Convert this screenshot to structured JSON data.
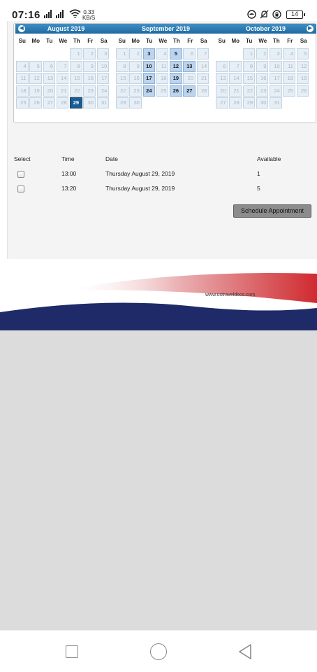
{
  "status_bar": {
    "time": "07:16",
    "speed_value": "0.33",
    "speed_unit": "KB/S",
    "battery": "14"
  },
  "calendar": {
    "weekdays": [
      "Su",
      "Mo",
      "Tu",
      "We",
      "Th",
      "Fr",
      "Sa"
    ],
    "months": [
      {
        "title": "August 2019",
        "offset": 4,
        "days": 31,
        "available": [],
        "selected": 29
      },
      {
        "title": "September 2019",
        "offset": 0,
        "days": 30,
        "available": [
          3,
          5,
          10,
          12,
          13,
          17,
          19,
          24,
          26,
          27
        ],
        "selected": null
      },
      {
        "title": "October 2019",
        "offset": 2,
        "days": 31,
        "available": [],
        "selected": null
      }
    ]
  },
  "slots": {
    "headers": {
      "select": "Select",
      "time": "Time",
      "date": "Date",
      "available": "Available"
    },
    "rows": [
      {
        "time": "13:00",
        "date": "Thursday August 29, 2019",
        "available": "1"
      },
      {
        "time": "13:20",
        "date": "Thursday August 29, 2019",
        "available": "5"
      }
    ]
  },
  "schedule_button": "Schedule Appointment",
  "banner": {
    "url": "www.ustraveldocs.com",
    "colors": {
      "red": "#cf2a2f",
      "navy": "#1f2a68"
    }
  }
}
